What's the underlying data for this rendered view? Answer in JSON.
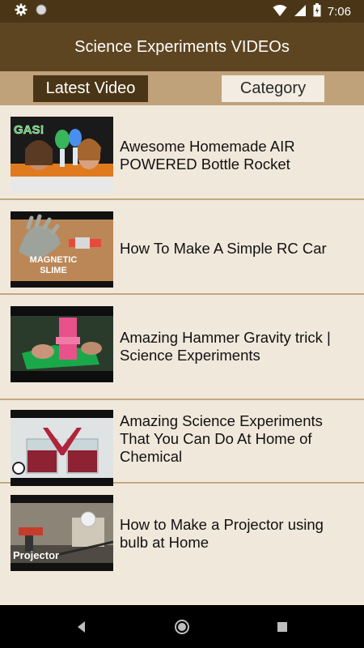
{
  "status_bar": {
    "time": "7:06"
  },
  "header": {
    "title": "Science Experiments VIDEOs"
  },
  "tabs": [
    {
      "label": "Latest Video",
      "selected": true
    },
    {
      "label": "Category",
      "selected": false
    }
  ],
  "videos": [
    {
      "title": "Awesome Homemade AIR POWERED Bottle Rocket",
      "thumb_text": "GAS!"
    },
    {
      "title": "How To Make A Simple RC Car",
      "thumb_text": "MAGNETIC SLIME"
    },
    {
      "title": "Amazing Hammer Gravity trick | Science Experiments",
      "thumb_text": ""
    },
    {
      "title": "Amazing Science Experiments That You Can Do At Home of Chemical",
      "thumb_text": ""
    },
    {
      "title": "How to Make a Projector using bulb at Home",
      "thumb_text": "Projector"
    }
  ],
  "colors": {
    "status_bar": "#4a3617",
    "title_bar": "#5d4521",
    "tabs_bar": "#bfa17a",
    "list_bg": "#f1e8dc",
    "divider": "#c5a87f"
  }
}
